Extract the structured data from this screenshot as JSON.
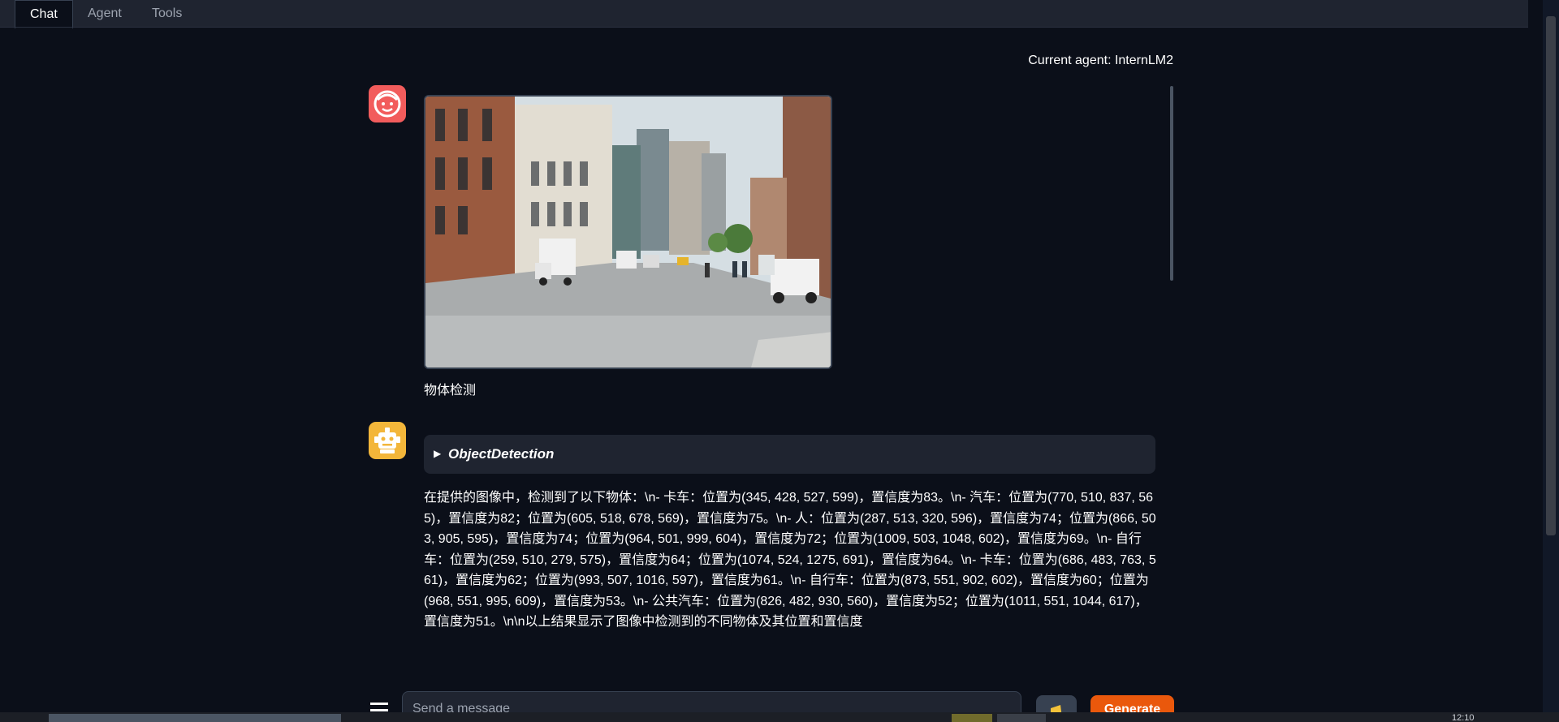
{
  "tabs": [
    {
      "label": "Chat",
      "active": true
    },
    {
      "label": "Agent",
      "active": false
    },
    {
      "label": "Tools",
      "active": false
    }
  ],
  "header": {
    "current_agent": "Current agent: InternLM2"
  },
  "messages": [
    {
      "role": "user",
      "avatar_icon": "smiley-face-icon",
      "image_icon": "street-scene-image",
      "text": "物体检测"
    },
    {
      "role": "bot",
      "avatar_icon": "robot-icon",
      "tool_call": {
        "arrow": "▶",
        "name": "ObjectDetection"
      },
      "text": "在提供的图像中，检测到了以下物体：\\n- 卡车：位置为(345, 428, 527, 599)，置信度为83。\\n- 汽车：位置为(770, 510, 837, 565)，置信度为82；位置为(605, 518, 678, 569)，置信度为75。\\n- 人：位置为(287, 513, 320, 596)，置信度为74；位置为(866, 503, 905, 595)，置信度为74；位置为(964, 501, 999, 604)，置信度为72；位置为(1009, 503, 1048, 602)，置信度为69。\\n- 自行车：位置为(259, 510, 279, 575)，置信度为64；位置为(1074, 524, 1275, 691)，置信度为64。\\n- 卡车：位置为(686, 483, 763, 561)，置信度为62；位置为(993, 507, 1016, 597)，置信度为61。\\n- 自行车：位置为(873, 551, 902, 602)，置信度为60；位置为(968, 551, 995, 609)，置信度为53。\\n- 公共汽车：位置为(826, 482, 930, 560)，置信度为52；位置为(1011, 551, 1044, 617)，置信度为51。\\n\\n以上结果显示了图像中检测到的不同物体及其位置和置信度"
    }
  ],
  "input": {
    "placeholder": "Send a message"
  },
  "buttons": {
    "generate": "Generate"
  },
  "taskbar": {
    "clock": "12:10"
  },
  "colors": {
    "accent": "#ea580c",
    "background": "#0b0f19",
    "user_avatar": "#f25c5c",
    "bot_avatar": "#f3b63a"
  }
}
